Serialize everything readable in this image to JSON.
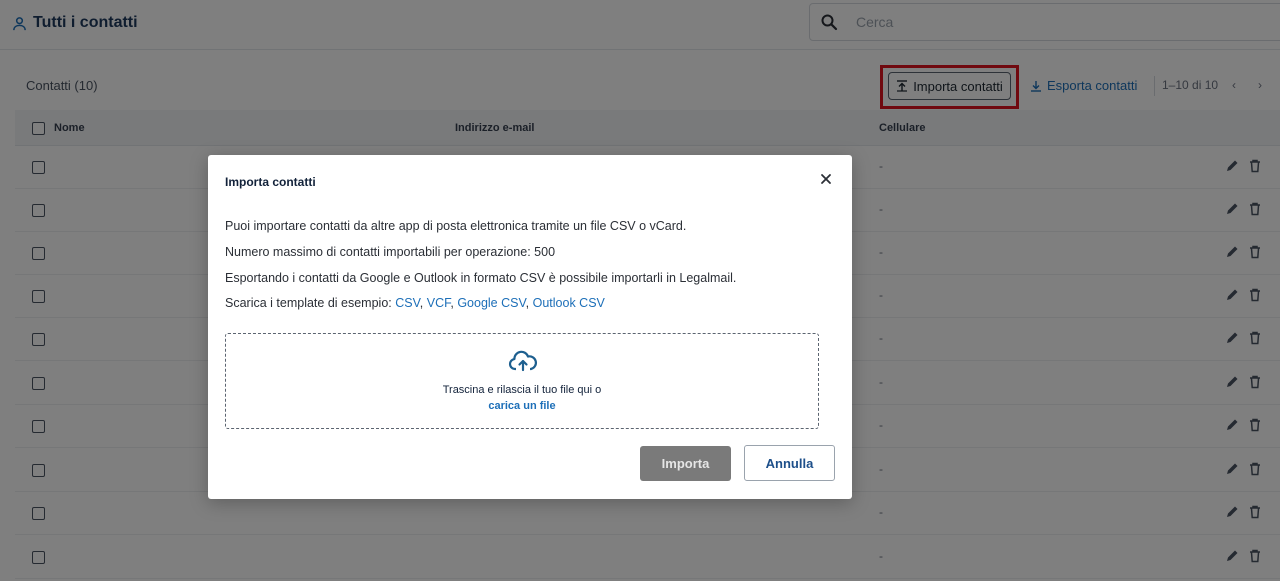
{
  "header": {
    "title": "Tutti i contatti",
    "search": {
      "placeholder": "Cerca",
      "value": ""
    }
  },
  "toolbar": {
    "title": "Contatti (10)",
    "import_label": "Importa contatti",
    "export_label": "Esporta contatti",
    "pagination": "1–10 di 10",
    "prev": "‹",
    "next": "›"
  },
  "table": {
    "columns": [
      "Nome",
      "Indirizzo e-mail",
      "Cellulare"
    ],
    "rows": [
      {
        "mobile": "-"
      },
      {
        "mobile": "-"
      },
      {
        "mobile": "-"
      },
      {
        "mobile": "-"
      },
      {
        "mobile": "-"
      },
      {
        "mobile": "-"
      },
      {
        "mobile": "-"
      },
      {
        "mobile": "-"
      },
      {
        "mobile": "-"
      },
      {
        "mobile": "-"
      }
    ]
  },
  "modal": {
    "title": "Importa contatti",
    "close_icon": "close-icon",
    "lines": [
      "Puoi importare contatti da altre app di posta elettronica tramite un file CSV o vCard.",
      "Numero massimo di contatti importabili per operazione: 500",
      "Esportando i contatti da Google e Outlook in formato CSV è possibile importarli in Legalmail."
    ],
    "templates_prefix": "Scarica i template di esempio: ",
    "templates": [
      "CSV",
      "VCF",
      "Google CSV",
      "Outlook CSV"
    ],
    "dropzone": {
      "text": "Trascina e rilascia il tuo file qui o",
      "link": "carica un file"
    },
    "import_button": "Importa",
    "cancel_button": "Annulla"
  },
  "colors": {
    "accent": "#1d6fb8",
    "highlight": "#e0131f",
    "disabled_button": "#7a7a7a"
  }
}
